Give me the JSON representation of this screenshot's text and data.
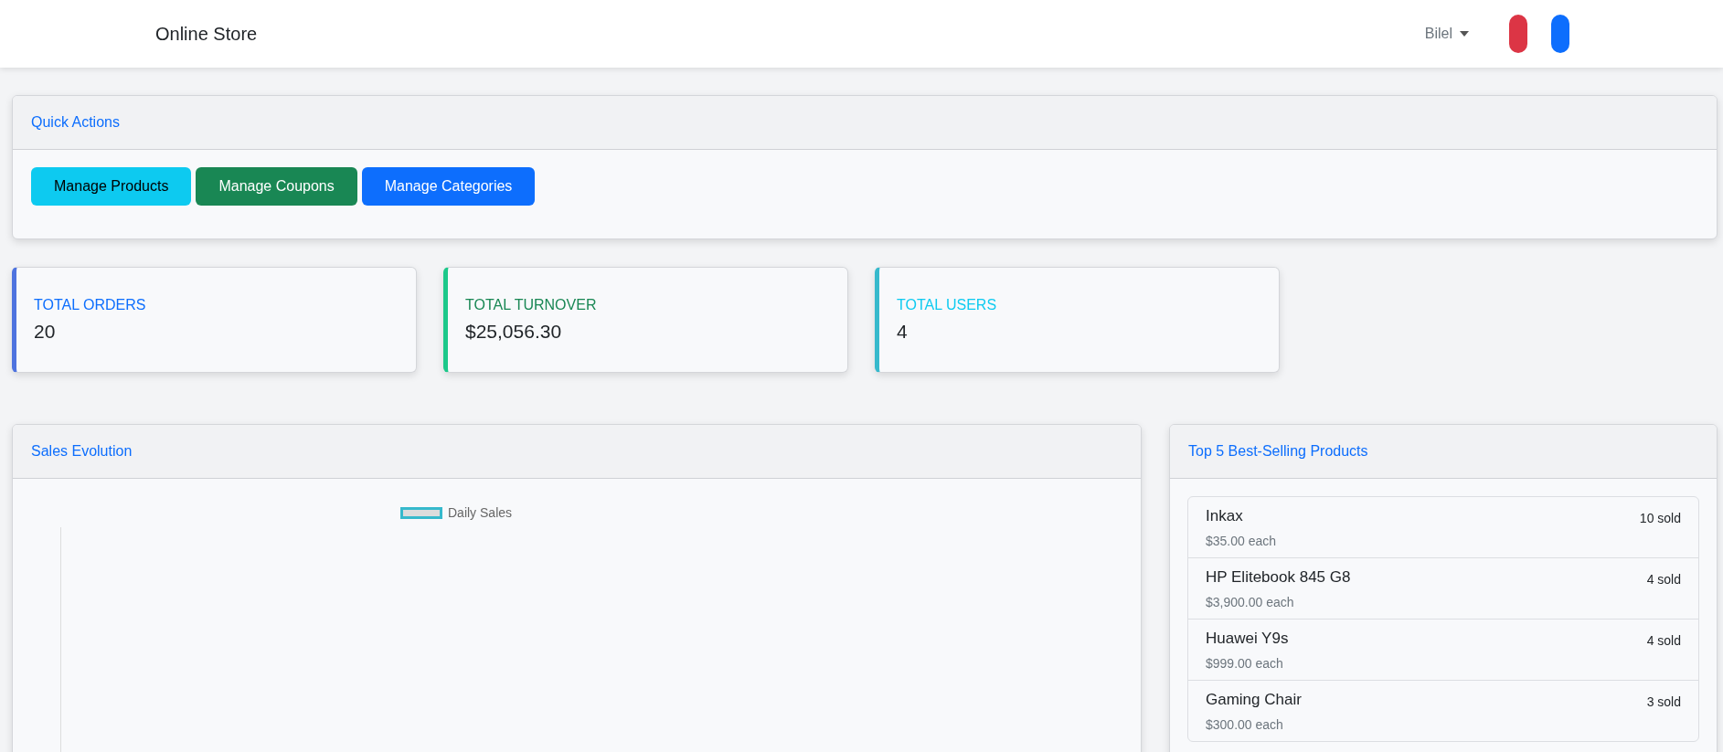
{
  "navbar": {
    "brand": "Online Store",
    "user_menu": "Bilel",
    "pills": [
      {
        "kind": "danger"
      },
      {
        "kind": "primary"
      }
    ]
  },
  "quick_actions": {
    "title": "Quick Actions",
    "buttons": [
      {
        "label": "Manage Products",
        "kind": "info"
      },
      {
        "label": "Manage Coupons",
        "kind": "success"
      },
      {
        "label": "Manage Categories",
        "kind": "primary"
      }
    ]
  },
  "stats": [
    {
      "label": "TOTAL ORDERS",
      "value": "20",
      "color": "#4e73df"
    },
    {
      "label": "TOTAL TURNOVER",
      "value": "$25,056.30",
      "color": "#1cc88a"
    },
    {
      "label": "TOTAL USERS",
      "value": "4",
      "color": "#36b9cc"
    }
  ],
  "sales": {
    "title": "Sales Evolution",
    "legend": "Daily Sales"
  },
  "top_products": {
    "title": "Top 5 Best-Selling Products",
    "items": [
      {
        "name": "Inkax",
        "price": "$35.00 each",
        "sold": "10 sold"
      },
      {
        "name": "HP Elitebook 845 G8",
        "price": "$3,900.00 each",
        "sold": "4 sold"
      },
      {
        "name": "Huawei Y9s",
        "price": "$999.00 each",
        "sold": "4 sold"
      },
      {
        "name": "Gaming Chair",
        "price": "$300.00 each",
        "sold": "3 sold"
      }
    ]
  }
}
